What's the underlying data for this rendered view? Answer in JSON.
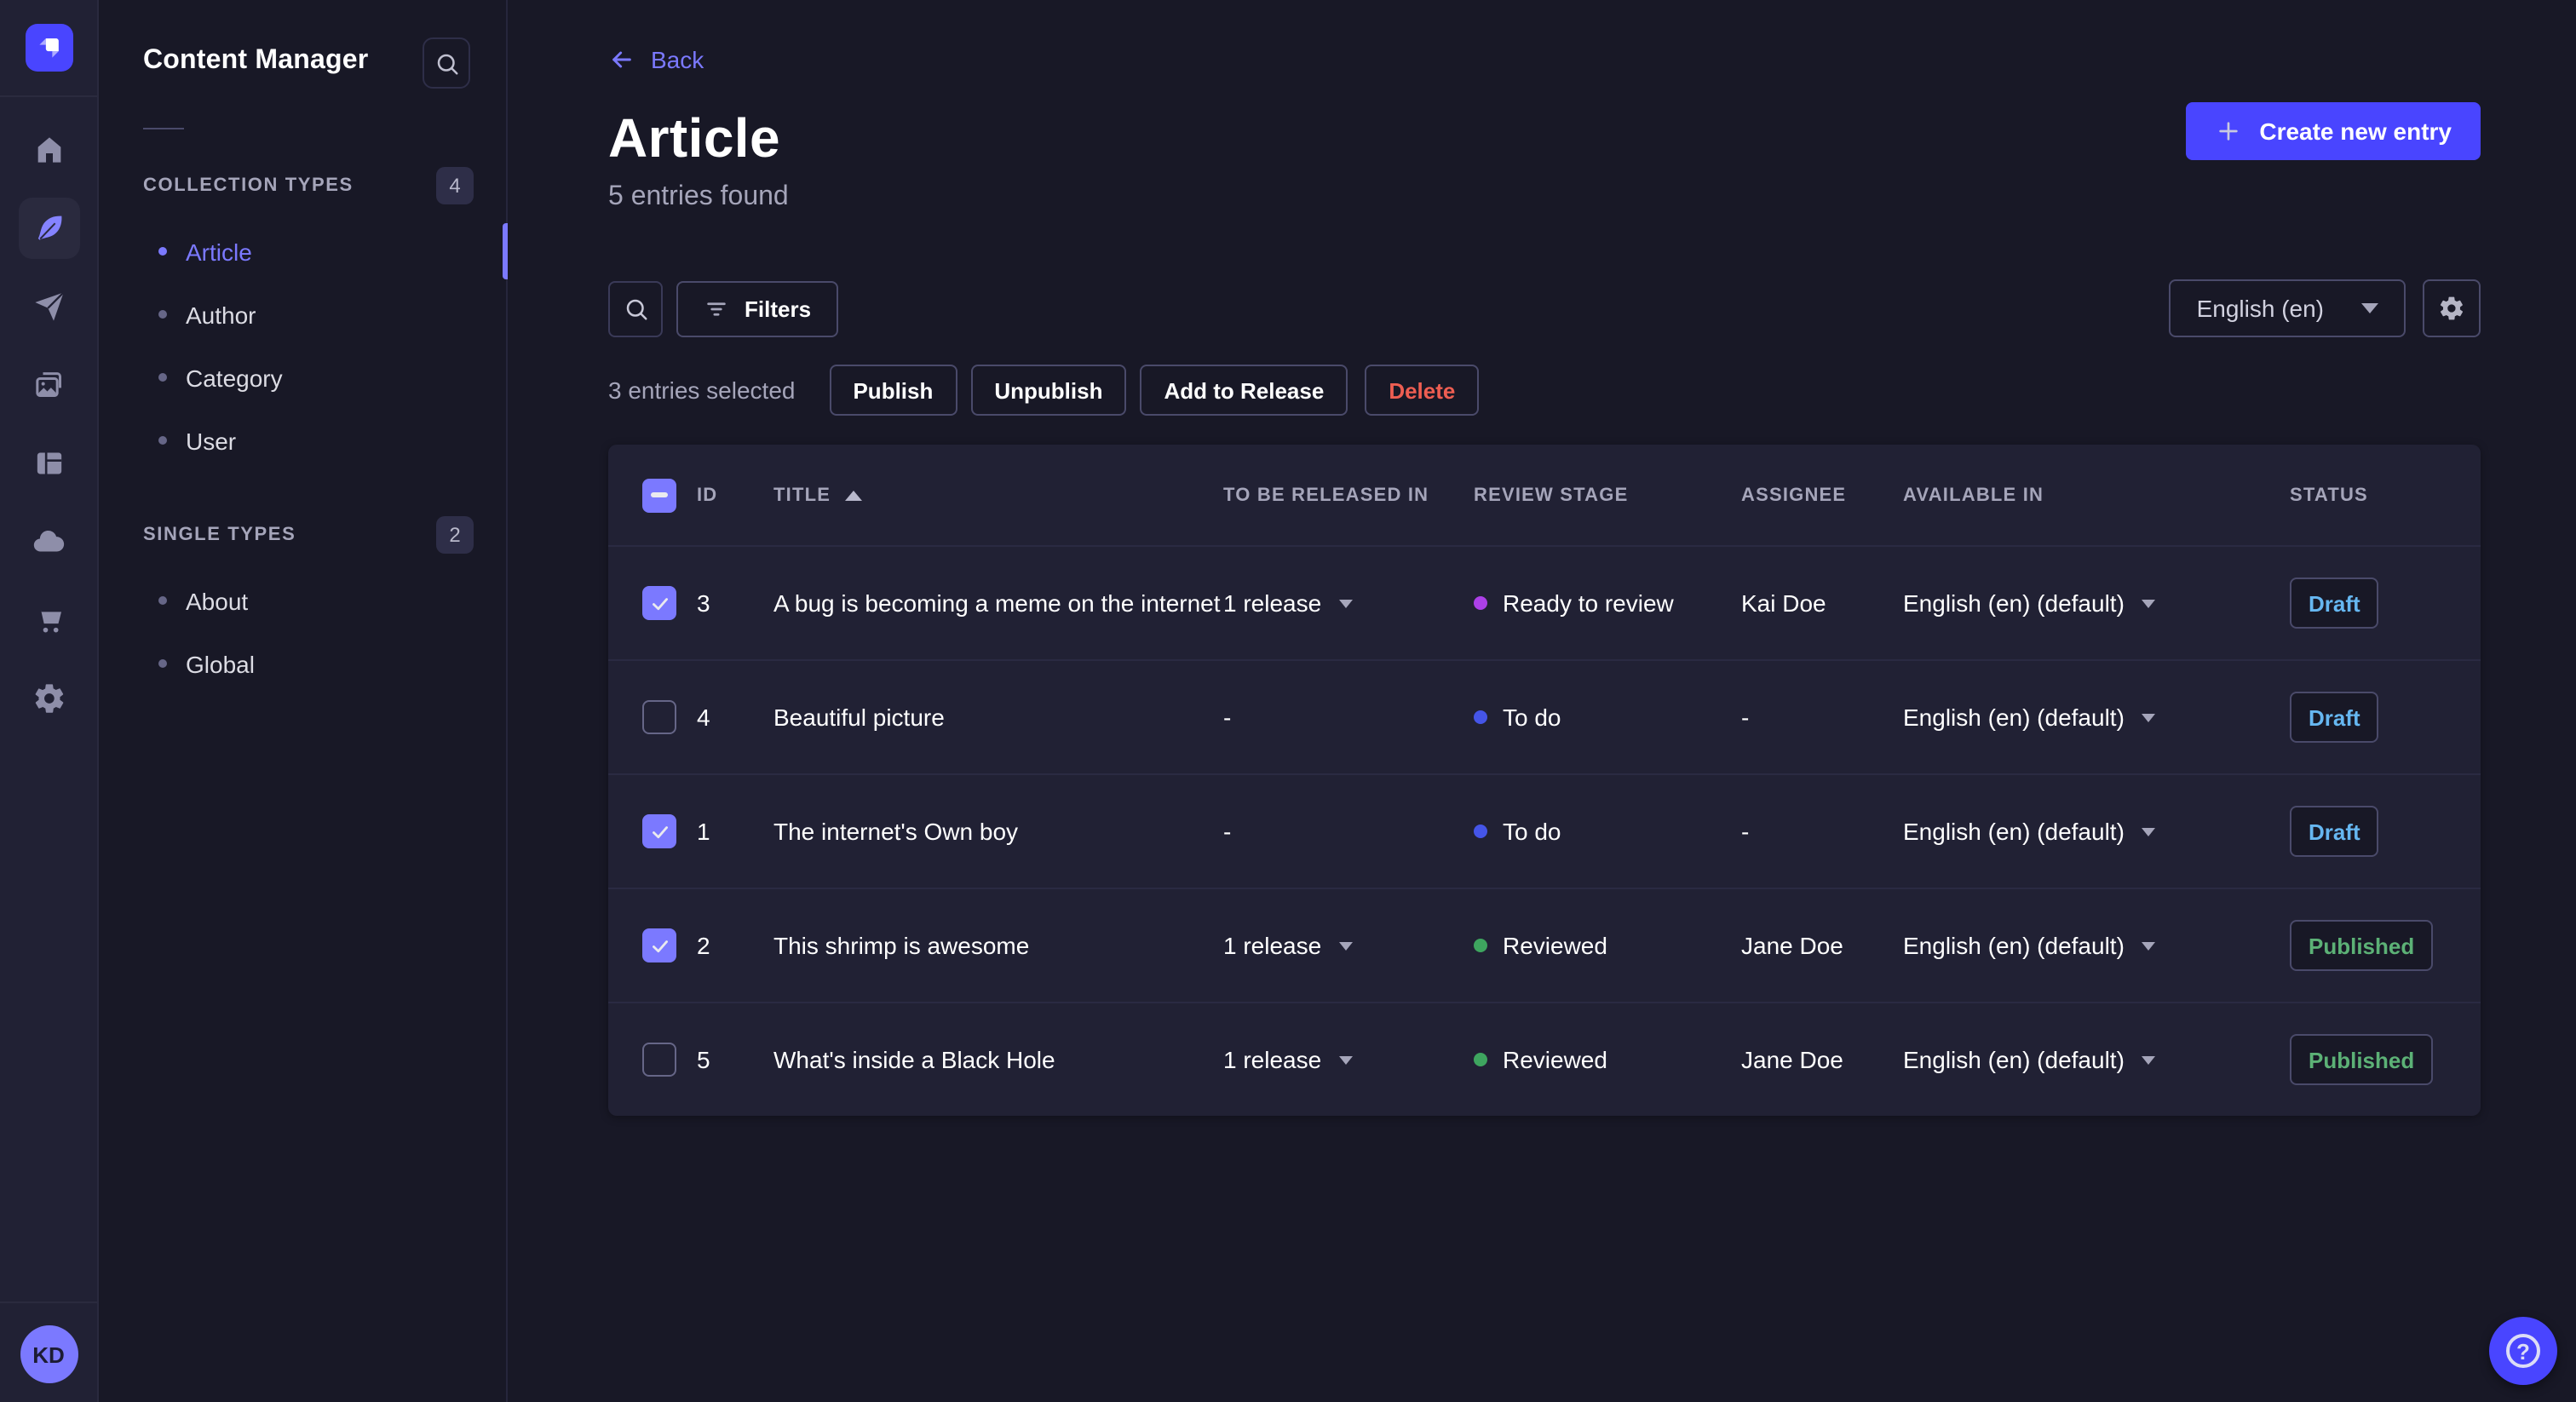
{
  "colors": {
    "brand": "#4945ff",
    "brand_light": "#7b79ff",
    "draft": "#66b7f1",
    "published": "#5cb176",
    "danger": "#ee5e52"
  },
  "rail": {
    "icons": [
      "strapi-logo",
      "home",
      "feather",
      "send",
      "media",
      "layout",
      "cloud",
      "cart",
      "settings"
    ],
    "active_icon": "feather",
    "avatar_initials": "KD"
  },
  "sidebar": {
    "title": "Content Manager",
    "sections": [
      {
        "label": "COLLECTION TYPES",
        "badge": "4",
        "items": [
          {
            "label": "Article",
            "active": true
          },
          {
            "label": "Author",
            "active": false
          },
          {
            "label": "Category",
            "active": false
          },
          {
            "label": "User",
            "active": false
          }
        ]
      },
      {
        "label": "SINGLE TYPES",
        "badge": "2",
        "items": [
          {
            "label": "About",
            "active": false
          },
          {
            "label": "Global",
            "active": false
          }
        ]
      }
    ]
  },
  "header": {
    "back_label": "Back",
    "title": "Article",
    "subtitle": "5 entries found",
    "create_label": "Create new entry"
  },
  "toolbar": {
    "filters_label": "Filters",
    "locale_value": "English (en)"
  },
  "selection": {
    "label": "3 entries selected",
    "publish_label": "Publish",
    "unpublish_label": "Unpublish",
    "add_to_release_label": "Add to Release",
    "delete_label": "Delete"
  },
  "table": {
    "header_checkbox_indeterminate": true,
    "sort": {
      "column": "TITLE",
      "direction": "asc"
    },
    "headers": {
      "id": "ID",
      "title": "TITLE",
      "released": "TO BE RELEASED IN",
      "review": "REVIEW STAGE",
      "assignee": "ASSIGNEE",
      "available": "AVAILABLE IN",
      "status": "STATUS"
    },
    "rows": [
      {
        "checked": true,
        "id": "3",
        "title": "A bug is becoming a meme on the internet",
        "released": "1 release",
        "review": {
          "label": "Ready to review",
          "color": "#ac40e8"
        },
        "assignee": "Kai Doe",
        "available": "English (en) (default)",
        "status": {
          "label": "Draft",
          "color": "#66b7f1"
        }
      },
      {
        "checked": false,
        "id": "4",
        "title": "Beautiful picture",
        "released": "-",
        "review": {
          "label": "To do",
          "color": "#4555e8"
        },
        "assignee": "-",
        "available": "English (en) (default)",
        "status": {
          "label": "Draft",
          "color": "#66b7f1"
        }
      },
      {
        "checked": true,
        "id": "1",
        "title": "The internet's Own boy",
        "released": "-",
        "review": {
          "label": "To do",
          "color": "#4555e8"
        },
        "assignee": "-",
        "available": "English (en) (default)",
        "status": {
          "label": "Draft",
          "color": "#66b7f1"
        }
      },
      {
        "checked": true,
        "id": "2",
        "title": "This shrimp is awesome",
        "released": "1 release",
        "review": {
          "label": "Reviewed",
          "color": "#3ea55f"
        },
        "assignee": "Jane Doe",
        "available": "English (en) (default)",
        "status": {
          "label": "Published",
          "color": "#5cb176"
        }
      },
      {
        "checked": false,
        "id": "5",
        "title": "What's inside a Black Hole",
        "released": "1 release",
        "review": {
          "label": "Reviewed",
          "color": "#3ea55f"
        },
        "assignee": "Jane Doe",
        "available": "English (en) (default)",
        "status": {
          "label": "Published",
          "color": "#5cb176"
        }
      }
    ]
  }
}
